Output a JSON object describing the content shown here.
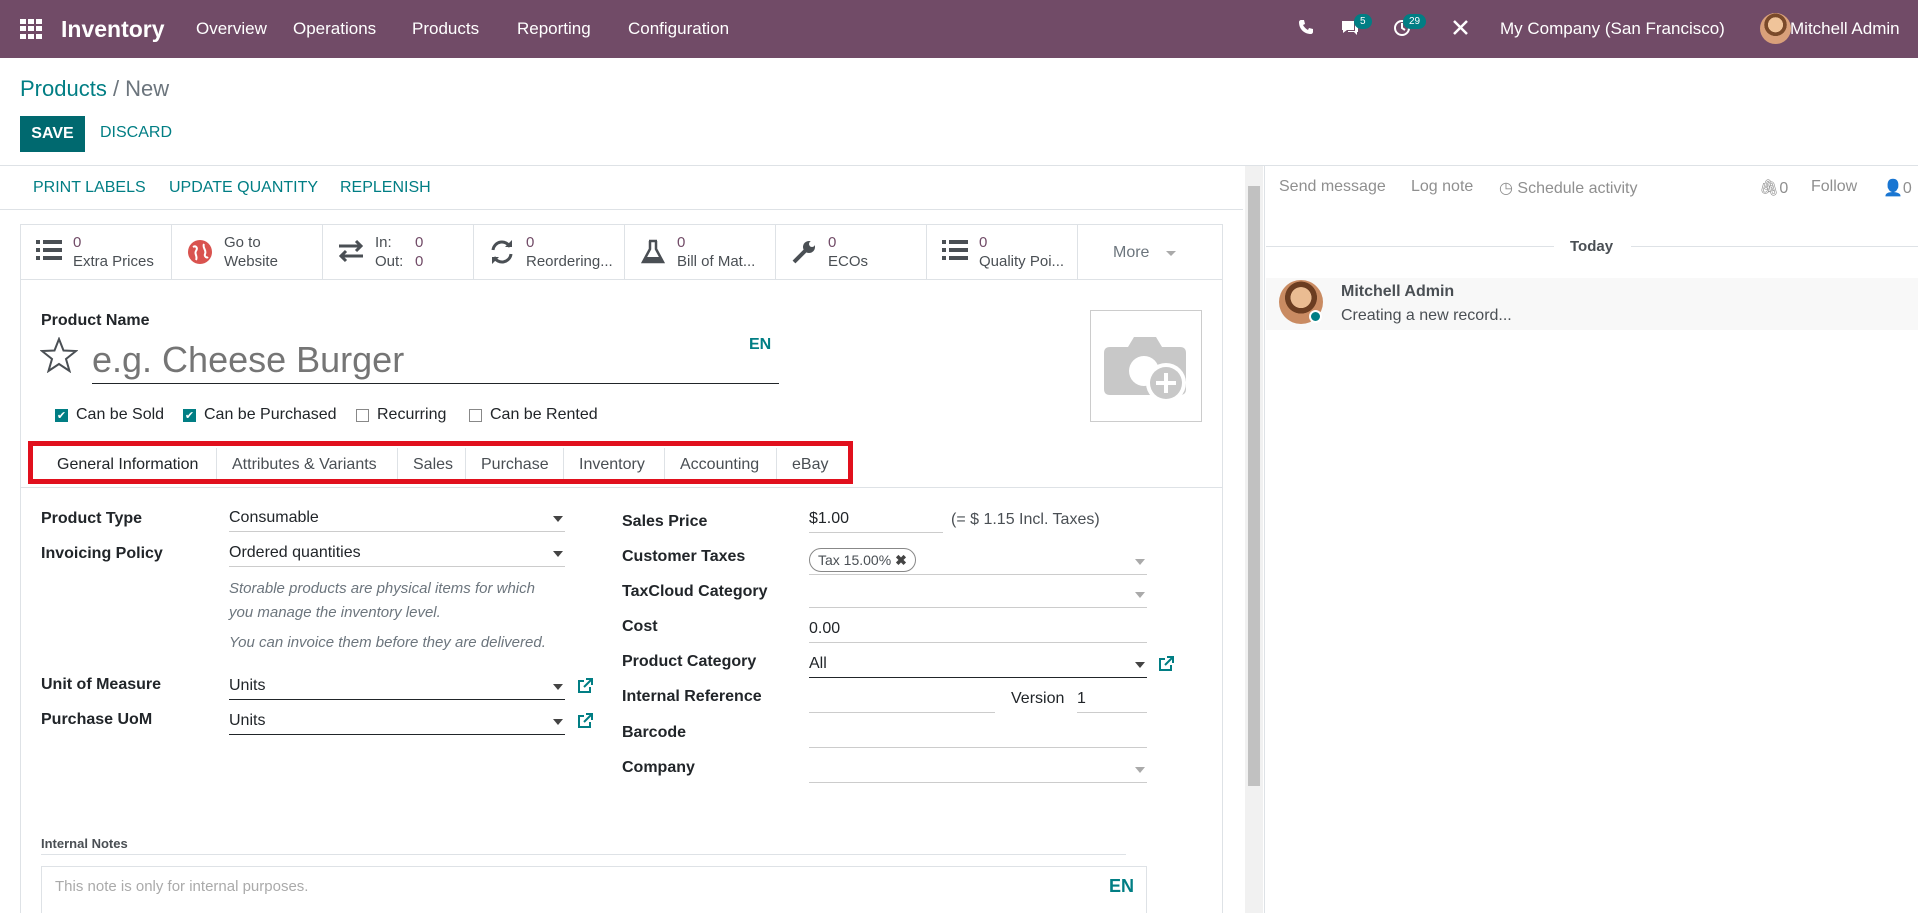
{
  "topbar": {
    "app": "Inventory",
    "menu": [
      "Overview",
      "Operations",
      "Products",
      "Reporting",
      "Configuration"
    ],
    "msg_count": "5",
    "activity_count": "29",
    "company": "My Company (San Francisco)",
    "user": "Mitchell Admin"
  },
  "breadcrumb": {
    "parent": "Products",
    "separator": " / ",
    "current": "New"
  },
  "buttons": {
    "save": "SAVE",
    "discard": "DISCARD"
  },
  "statusbar": [
    "PRINT LABELS",
    "UPDATE QUANTITY",
    "REPLENISH"
  ],
  "smart": {
    "extra": {
      "v": "0",
      "l": "Extra Prices"
    },
    "website": {
      "l1": "Go to",
      "l2": "Website"
    },
    "inout": {
      "in_l": "In:",
      "in_v": "0",
      "out_l": "Out:",
      "out_v": "0"
    },
    "reorder": {
      "v": "0",
      "l": "Reordering..."
    },
    "bom": {
      "v": "0",
      "l": "Bill of Mat..."
    },
    "ecos": {
      "v": "0",
      "l": "ECOs"
    },
    "quality": {
      "v": "0",
      "l": "Quality Poi..."
    },
    "more": "More"
  },
  "product": {
    "name_label": "Product Name",
    "name_placeholder": "e.g. Cheese Burger",
    "lang": "EN"
  },
  "checks": [
    {
      "label": "Can be Sold",
      "on": true
    },
    {
      "label": "Can be Purchased",
      "on": true
    },
    {
      "label": "Recurring",
      "on": false
    },
    {
      "label": "Can be Rented",
      "on": false
    }
  ],
  "tabs": [
    "General Information",
    "Attributes & Variants",
    "Sales",
    "Purchase",
    "Inventory",
    "Accounting",
    "eBay"
  ],
  "left": {
    "type_label": "Product Type",
    "type_value": "Consumable",
    "policy_label": "Invoicing Policy",
    "policy_value": "Ordered quantities",
    "note1": "Storable products are physical items for which",
    "note2": "you manage the inventory level.",
    "note3": "You can invoice them before they are delivered.",
    "uom_label": "Unit of Measure",
    "uom_value": "Units",
    "puom_label": "Purchase UoM",
    "puom_value": "Units"
  },
  "right": {
    "price_label": "Sales Price",
    "price_value": "$1.00",
    "price_incl": "(= $ 1.15 Incl. Taxes)",
    "taxes_label": "Customer Taxes",
    "tax_tag": "Tax 15.00%",
    "taxcloud_label": "TaxCloud Category",
    "cost_label": "Cost",
    "cost_value": "0.00",
    "categ_label": "Product Category",
    "categ_value": "All",
    "ref_label": "Internal Reference",
    "version_label": "Version",
    "version_value": "1",
    "barcode_label": "Barcode",
    "company_label": "Company"
  },
  "notes": {
    "label": "Internal Notes",
    "placeholder": "This note is only for internal purposes.",
    "lang": "EN"
  },
  "chatter": {
    "send": "Send message",
    "log": "Log note",
    "schedule": "Schedule activity",
    "attach_count": "0",
    "follow": "Follow",
    "followers": "0",
    "today": "Today",
    "author": "Mitchell Admin",
    "body": "Creating a new record..."
  }
}
